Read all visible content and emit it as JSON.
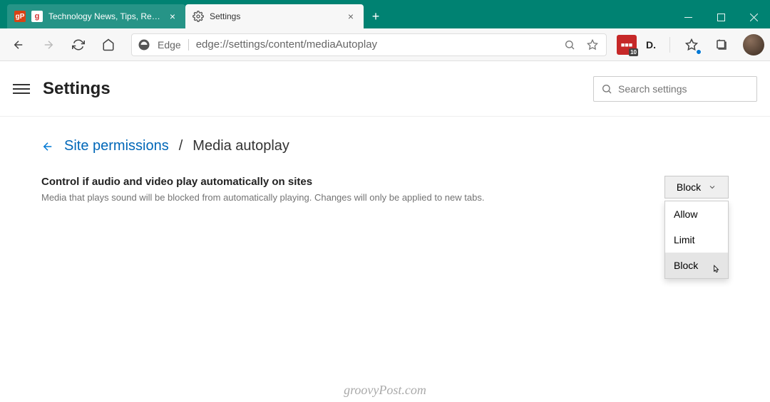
{
  "tabs": [
    {
      "favicon": "gP",
      "favicon2": "g",
      "title": "Technology News, Tips, Reviews,",
      "active": false
    },
    {
      "icon": "gear",
      "title": "Settings",
      "active": true
    }
  ],
  "address": {
    "label": "Edge",
    "url": "edge://settings/content/mediaAutoplay"
  },
  "toolbar_ext": {
    "red_badge": "10",
    "d_label": "D."
  },
  "header": {
    "title": "Settings",
    "search_placeholder": "Search settings"
  },
  "breadcrumb": {
    "parent": "Site permissions",
    "sep": "/",
    "current": "Media autoplay"
  },
  "setting": {
    "title": "Control if audio and video play automatically on sites",
    "desc": "Media that plays sound will be blocked from automatically playing. Changes will only be applied to new tabs.",
    "value": "Block"
  },
  "dropdown": {
    "options": [
      "Allow",
      "Limit",
      "Block"
    ],
    "hovered": "Block"
  },
  "watermark": "groovyPost.com"
}
